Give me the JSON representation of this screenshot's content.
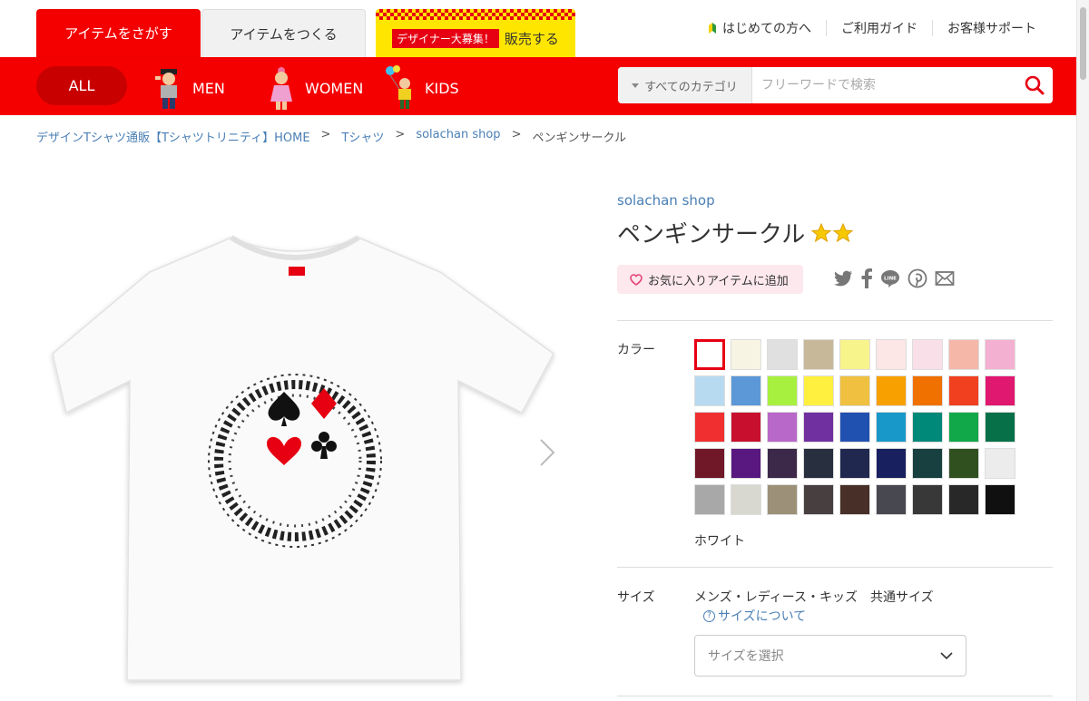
{
  "header": {
    "tabs": {
      "find": "アイテムをさがす",
      "make": "アイテムをつくる",
      "recruit_badge": "デザイナー大募集！",
      "sell": "販売する"
    },
    "links": {
      "beginner": "はじめての方へ",
      "guide": "ご利用ガイド",
      "support": "お客様サポート"
    }
  },
  "nav": {
    "all": "ALL",
    "men": "MEN",
    "women": "WOMEN",
    "kids": "KIDS",
    "search_category": "すべてのカテゴリ",
    "search_placeholder": "フリーワードで検索"
  },
  "breadcrumb": {
    "home": "デザインTシャツ通販【Tシャツトリニティ】HOME",
    "category": "Tシャツ",
    "shop": "solachan shop",
    "current": "ペンギンサークル",
    "separator": ">"
  },
  "product": {
    "shop_name": "solachan shop",
    "title": "ペンギンサークル",
    "favorite_label": "お気に入りアイテムに追加",
    "color_label": "カラー",
    "selected_color_name": "ホワイト",
    "size_label": "サイズ",
    "size_type": "メンズ・レディース・キッズ　共通サイズ",
    "size_help": "サイズについて",
    "size_placeholder": "サイズを選択"
  },
  "colors": [
    "#ffffff",
    "#f8f4e4",
    "#e0e0e0",
    "#c8b89a",
    "#f8f48c",
    "#fde6e6",
    "#f8dfe8",
    "#f5b8a8",
    "#f4b0d0",
    "#b8daf0",
    "#5c98d8",
    "#a8f040",
    "#fff040",
    "#f0c040",
    "#f7a000",
    "#f07000",
    "#f04020",
    "#e01870",
    "#f03030",
    "#c8102e",
    "#b868c8",
    "#7030a0",
    "#2050b0",
    "#1898c8",
    "#008878",
    "#10a848",
    "#087048",
    "#701828",
    "#581880",
    "#3c2848",
    "#283040",
    "#202850",
    "#182060",
    "#184040",
    "#305020",
    "#ececec",
    "#a8a8a8",
    "#d8d8d0",
    "#9c9078",
    "#484040",
    "#483028",
    "#484850",
    "#383838",
    "#282828",
    "#101010"
  ],
  "accent": "#f40000"
}
